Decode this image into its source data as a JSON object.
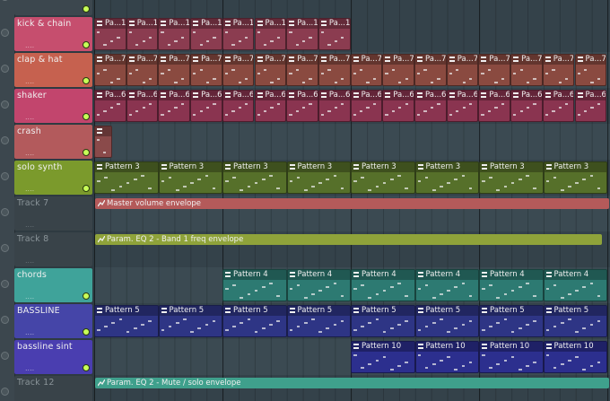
{
  "tracks": [
    {
      "name": "kick & chain",
      "color": "#c64e6e",
      "disabled": false,
      "clip_label": "Pa...1",
      "clip_color": "#8b3c50",
      "clip_start": 0,
      "clip_count": 8,
      "clip_width": 35.7,
      "header_label_only": true
    },
    {
      "name": "clap & hat",
      "color": "#c6614f",
      "disabled": false,
      "clip_label": "Pa...7",
      "clip_color": "#8a4a40",
      "clip_start": 0,
      "clip_count": 16,
      "clip_width": 35.7
    },
    {
      "name": "shaker",
      "color": "#c2456d",
      "disabled": false,
      "clip_label": "Pa...6",
      "clip_color": "#8a3450",
      "clip_start": 0,
      "clip_count": 16,
      "clip_width": 35.7
    },
    {
      "name": "crash",
      "color": "#b35a5c",
      "disabled": false,
      "clip_label": "",
      "clip_color": "#8a4a4a",
      "clip_start": 0,
      "clip_count": 1,
      "clip_width": 20
    },
    {
      "name": "solo synth",
      "color": "#7b9a2c",
      "disabled": false,
      "clip_label": "Pattern 3",
      "clip_color": "#56702a",
      "clip_start": 0,
      "clip_count": 8,
      "clip_width": 71.5
    },
    {
      "name": "Track 7",
      "color": "#394349",
      "disabled": true,
      "envelope": {
        "label": "Master volume envelope",
        "color": "#b45a5a",
        "start": 0,
        "width": 575
      }
    },
    {
      "name": "Track 8",
      "color": "#394349",
      "disabled": true,
      "envelope": {
        "label": "Param. EQ 2 - Band 1 freq envelope",
        "color": "#8fa33a",
        "start": 0,
        "width": 565
      }
    },
    {
      "name": "chords",
      "color": "#3fa39a",
      "disabled": false,
      "clip_label": "Pattern 4",
      "clip_color": "#2d7a72",
      "clip_start": 2,
      "clip_count": 6,
      "clip_width": 71.5
    },
    {
      "name": "BASSLINE",
      "color": "#4545a8",
      "disabled": false,
      "clip_label": "Pattern 5",
      "clip_color": "#2e3585",
      "clip_start": 0,
      "clip_count": 8,
      "clip_width": 71.5
    },
    {
      "name": "bassline sint",
      "color": "#4a3eb0",
      "disabled": false,
      "clip_label": "Pattern 10",
      "clip_color": "#2c2f8e",
      "clip_start": 4,
      "clip_count": 4,
      "clip_width": 71.5
    },
    {
      "name": "Track 12",
      "color": "#394349",
      "disabled": true,
      "envelope": {
        "label": "Param. EQ 2 - Mute / solo envelope",
        "color": "#3fa08c",
        "start": 0,
        "width": 575
      }
    }
  ],
  "dots": "....",
  "colors": {
    "background": "#2e3a41",
    "led_on": "#c8ff58"
  }
}
